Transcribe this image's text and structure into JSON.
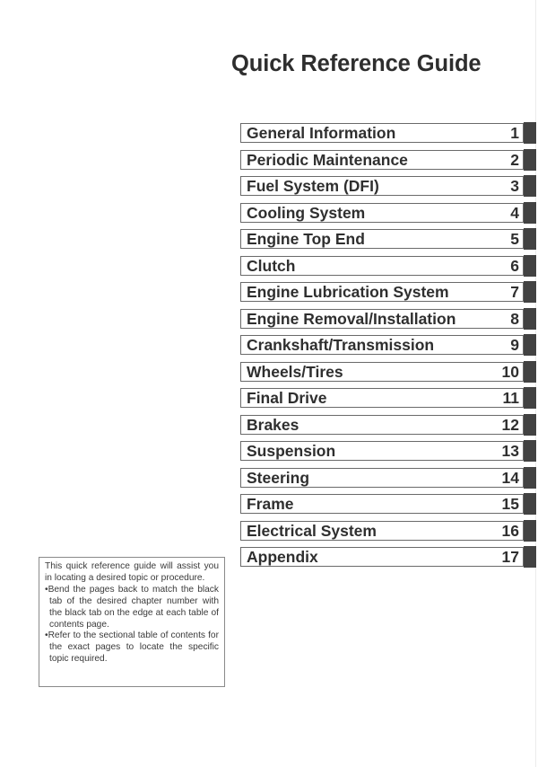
{
  "page": {
    "title": "Quick Reference Guide"
  },
  "colors": {
    "tab": "#424242",
    "text": "#2f2f2f",
    "border": "#6a6a6a"
  },
  "toc": {
    "items": [
      {
        "label": "General Information",
        "number": "1"
      },
      {
        "label": "Periodic Maintenance",
        "number": "2"
      },
      {
        "label": "Fuel System (DFI)",
        "number": "3"
      },
      {
        "label": "Cooling System",
        "number": "4"
      },
      {
        "label": "Engine Top End",
        "number": "5"
      },
      {
        "label": "Clutch",
        "number": "6"
      },
      {
        "label": "Engine Lubrication System",
        "number": "7"
      },
      {
        "label": "Engine Removal/Installation",
        "number": "8"
      },
      {
        "label": "Crankshaft/Transmission",
        "number": "9"
      },
      {
        "label": "Wheels/Tires",
        "number": "10"
      },
      {
        "label": "Final Drive",
        "number": "11"
      },
      {
        "label": "Brakes",
        "number": "12"
      },
      {
        "label": "Suspension",
        "number": "13"
      },
      {
        "label": "Steering",
        "number": "14"
      },
      {
        "label": "Frame",
        "number": "15"
      },
      {
        "label": "Electrical System",
        "number": "16"
      },
      {
        "label": "Appendix",
        "number": "17"
      }
    ]
  },
  "note": {
    "intro": "This quick reference guide will assist you in locating a desired topic or procedure.",
    "bullets": [
      "•Bend the pages back to match the black tab of the desired chapter number with the black tab on the edge at each table of contents page.",
      "•Refer to the sectional table of contents for the exact pages to locate the specific topic required."
    ]
  }
}
